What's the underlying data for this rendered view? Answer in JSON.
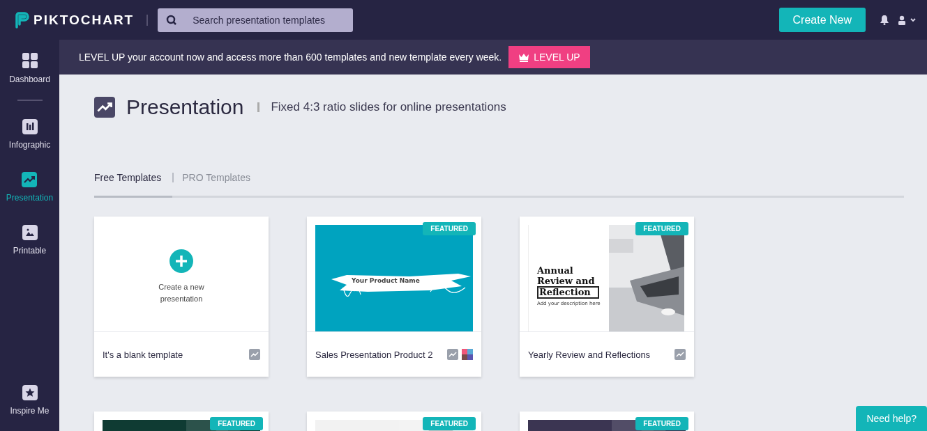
{
  "header": {
    "logo": "PIKTOCHART",
    "search": {
      "placeholder": "Search presentation templates"
    },
    "create_button": "Create New"
  },
  "sidebar": {
    "items": [
      {
        "label": "Dashboard",
        "selected": false
      },
      {
        "label": "Infographic",
        "selected": false
      },
      {
        "label": "Presentation",
        "selected": true
      },
      {
        "label": "Printable",
        "selected": false
      }
    ],
    "bottom_item": {
      "label": "Inspire Me",
      "selected": false
    }
  },
  "banner": {
    "text": "LEVEL UP your account now and access more than 600 templates and new template every week.",
    "button": "LEVEL UP"
  },
  "page": {
    "title": "Presentation",
    "subtitle": "Fixed 4:3 ratio slides for online presentations"
  },
  "tabs": [
    {
      "label": "Free Templates",
      "selected": true
    },
    {
      "label": "PRO Templates",
      "selected": false
    }
  ],
  "cards": [
    {
      "kind": "blank",
      "action": "Create a new presentation",
      "title": "It's a blank template",
      "featured": false,
      "palette": false
    },
    {
      "kind": "brush",
      "slide_text": "Your Product Name",
      "title": "Sales Presentation Product 2",
      "featured": true,
      "badge": "FEATURED",
      "palette": true
    },
    {
      "kind": "review",
      "slide_text": "Annual Review and",
      "slide_boxed": "Reflection",
      "slide_caption": "Add your description here",
      "title": "Yearly Review and Reflections",
      "featured": true,
      "badge": "FEATURED",
      "palette": false
    },
    {
      "kind": "picture",
      "featured": true,
      "badge": "FEATURED"
    },
    {
      "kind": "picture",
      "featured": true,
      "badge": "FEATURED"
    },
    {
      "kind": "picture",
      "featured": true,
      "badge": "FEATURED"
    }
  ],
  "help_button": "Need help?"
}
